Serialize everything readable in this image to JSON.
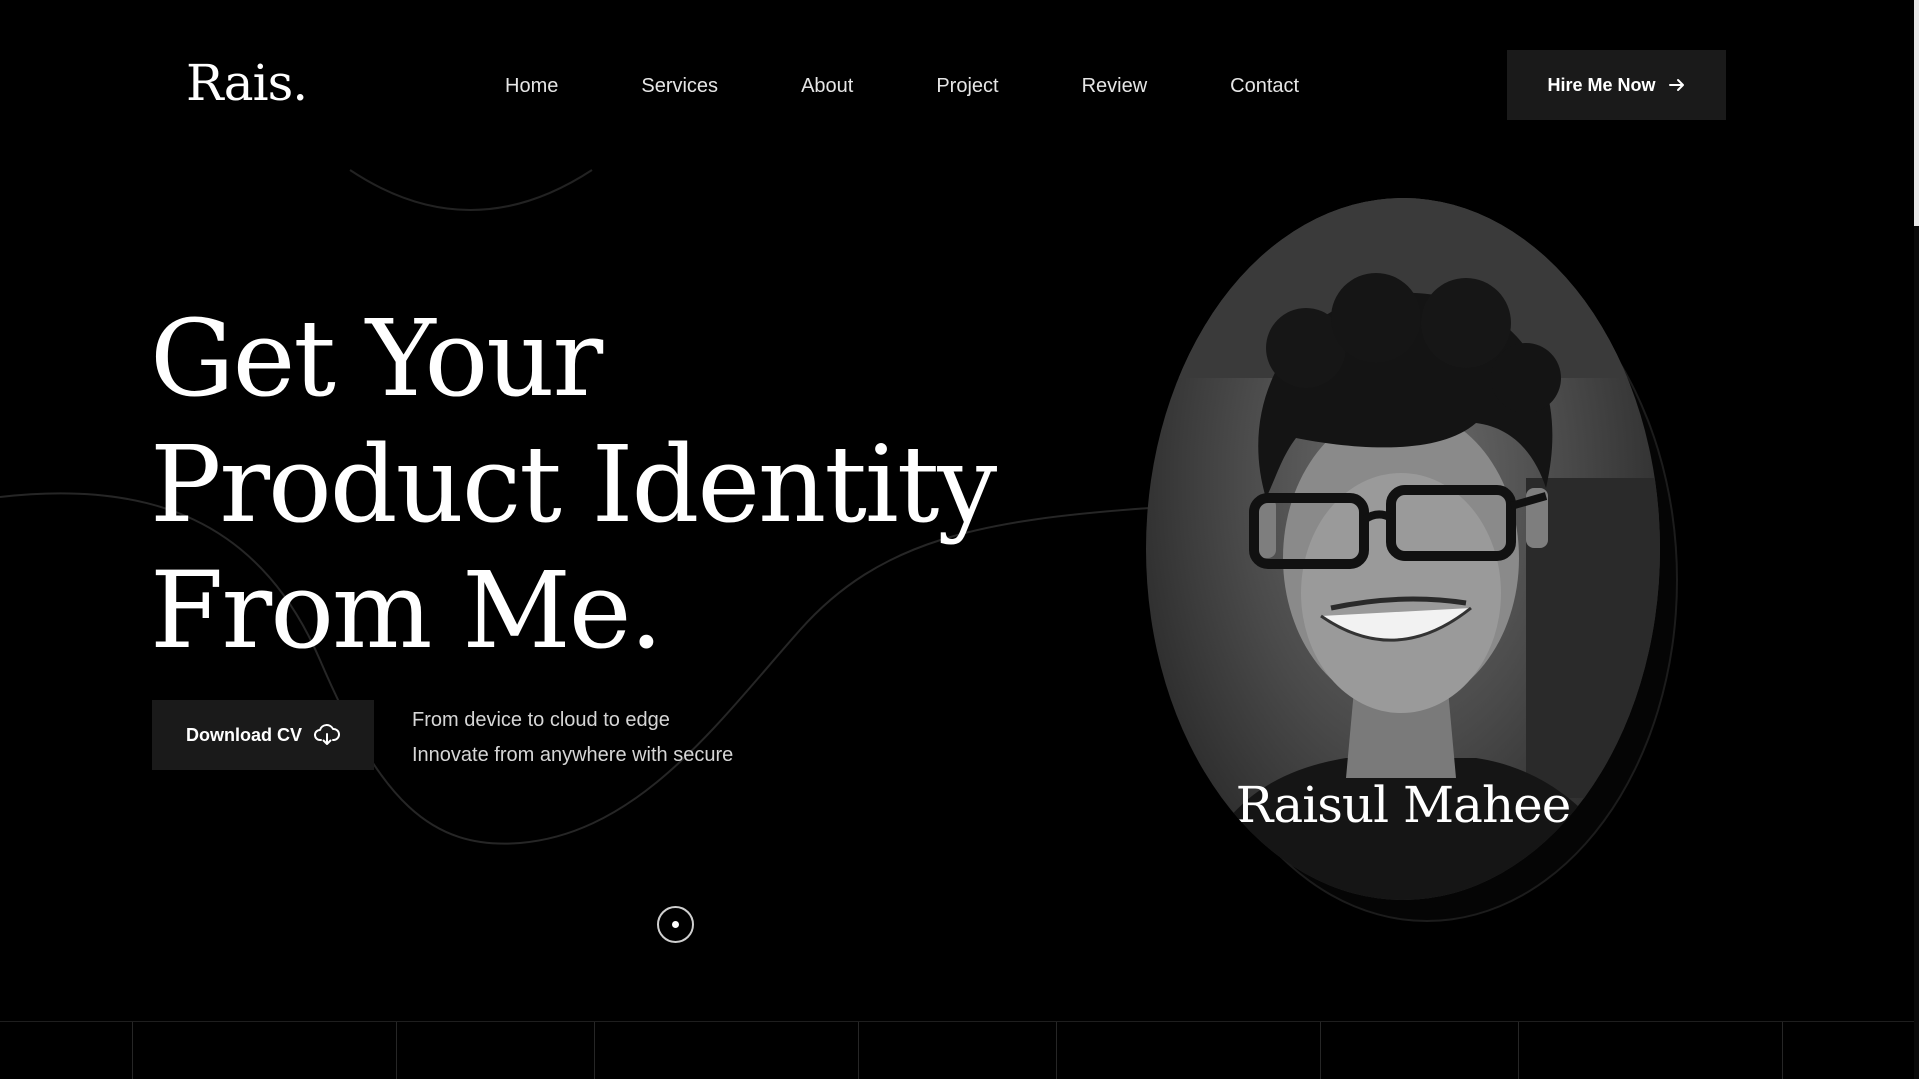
{
  "header": {
    "logo": "Rais.",
    "nav": [
      "Home",
      "Services",
      "About",
      "Project",
      "Review",
      "Contact"
    ],
    "hire_label": "Hire Me Now",
    "hire_icon": "arrow-right-icon"
  },
  "hero": {
    "headline": [
      "Get Your",
      "Product Identity",
      "From Me."
    ],
    "cv_label": "Download CV",
    "cv_icon": "cloud-download-icon",
    "tagline": [
      "From device to cloud to edge",
      "Innovate from anywhere with secure"
    ],
    "scroll_icon": "scroll-indicator-icon"
  },
  "portrait": {
    "name": "Raisul Mahee"
  },
  "colors": {
    "background": "#000000",
    "button_bg": "#1a1a1a",
    "text": "#ffffff"
  }
}
